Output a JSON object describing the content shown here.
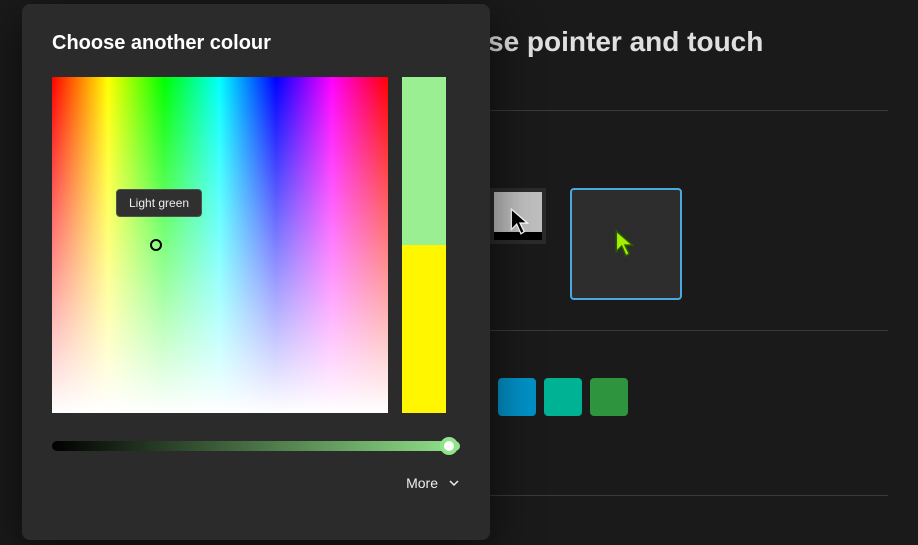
{
  "page": {
    "title_fragment": "se pointer and touch"
  },
  "modal": {
    "title": "Choose another colour",
    "tooltip": "Light green",
    "current_color_hex": "#9aef92",
    "previous_color_hex": "#fff600",
    "more_label": "More"
  },
  "pointer_styles": {
    "inverted": {
      "label": "inverted"
    },
    "custom": {
      "label": "custom",
      "cursor_color": "#a6ef00",
      "selected": true
    }
  },
  "color_swatches": [
    {
      "name": "steel-blue",
      "hex": "#0091c6"
    },
    {
      "name": "teal",
      "hex": "#00b294"
    },
    {
      "name": "green",
      "hex": "#2f943e"
    }
  ]
}
